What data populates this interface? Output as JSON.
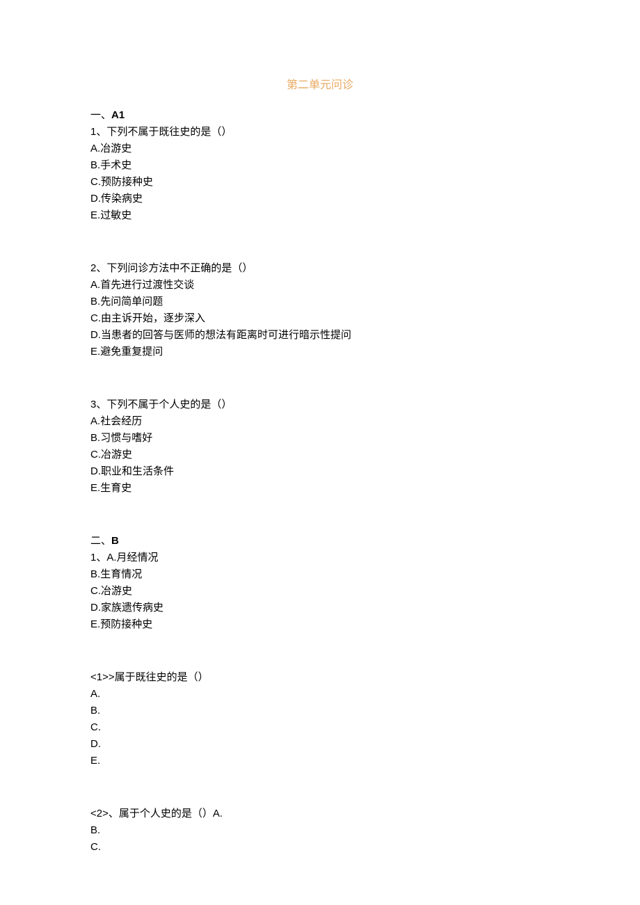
{
  "title": "第二单元问诊",
  "sectionA": {
    "header_prefix": "一、",
    "header_label": "A1",
    "questions": [
      {
        "num": "1、",
        "stem": "下列不属于既往史的是（）",
        "options": [
          {
            "letter": "A.",
            "text": "冶游史"
          },
          {
            "letter": "B.",
            "text": "手术史"
          },
          {
            "letter": "C.",
            "text": "预防接种史"
          },
          {
            "letter": "D.",
            "text": "传染病史"
          },
          {
            "letter": "E.",
            "text": "过敏史"
          }
        ]
      },
      {
        "num": "2、",
        "stem": "下列问诊方法中不正确的是（）",
        "options": [
          {
            "letter": "A.",
            "text": "首先进行过渡性交谈"
          },
          {
            "letter": "B.",
            "text": "先问简单问题"
          },
          {
            "letter": "C.",
            "text": "由主诉开始，逐步深入"
          },
          {
            "letter": "D.",
            "text": "当患者的回答与医师的想法有距离时可进行暗示性提问"
          },
          {
            "letter": "E.",
            "text": "避免重复提问"
          }
        ]
      },
      {
        "num": "3、",
        "stem": "下列不属于个人史的是（）",
        "options": [
          {
            "letter": "A.",
            "text": "社会经历"
          },
          {
            "letter": "B.",
            "text": "习惯与嗜好"
          },
          {
            "letter": "C.",
            "text": "冶游史"
          },
          {
            "letter": "D.",
            "text": "职业和生活条件"
          },
          {
            "letter": "E.",
            "text": "生育史"
          }
        ]
      }
    ]
  },
  "sectionB": {
    "header_prefix": "二、",
    "header_label": "B",
    "shared": {
      "num": "1、",
      "options": [
        {
          "letter": "A.",
          "text": "月经情况"
        },
        {
          "letter": "B.",
          "text": "生育情况"
        },
        {
          "letter": "C.",
          "text": "冶游史"
        },
        {
          "letter": "D.",
          "text": "家族遗传病史"
        },
        {
          "letter": "E.",
          "text": "预防接种史"
        }
      ]
    },
    "sub1": {
      "stem_prefix": "<1>>",
      "stem": "属于既往史的是（）",
      "options": [
        {
          "letter": "A."
        },
        {
          "letter": "B."
        },
        {
          "letter": "C."
        },
        {
          "letter": "D."
        },
        {
          "letter": "E."
        }
      ]
    },
    "sub2": {
      "stem_prefix": "<2>、",
      "stem": "属于个人史的是（）",
      "inline_after": "A.",
      "options": [
        {
          "letter": "B."
        },
        {
          "letter": "C."
        }
      ]
    }
  }
}
